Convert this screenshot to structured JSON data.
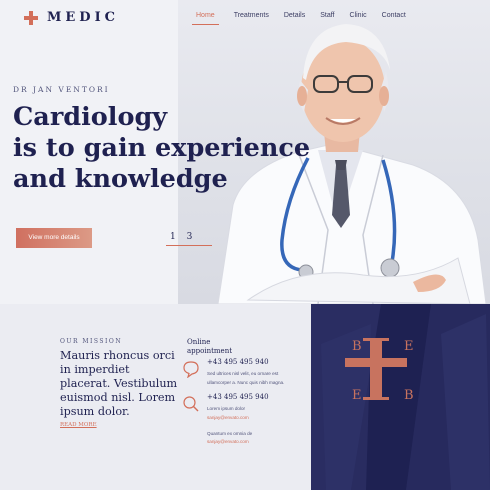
{
  "brand": {
    "name": "MEDIC",
    "accent": "#d36f5a",
    "navy": "#1f2150"
  },
  "nav": [
    {
      "label": "Home",
      "active": true
    },
    {
      "label": "Treatments",
      "active": false
    },
    {
      "label": "Details",
      "active": false
    },
    {
      "label": "Staff",
      "active": false
    },
    {
      "label": "Clinic",
      "active": false
    },
    {
      "label": "Contact",
      "active": false
    }
  ],
  "hero": {
    "eyebrow": "DR JAN VENTORI",
    "headline": [
      "Cardiology",
      "is to gain experience",
      "and knowledge"
    ],
    "cta": "View more details",
    "pager": {
      "current": "1",
      "total": "3"
    }
  },
  "mission": {
    "label": "OUR MISSION",
    "text": "Mauris rhoncus orci in imperdiet placerat. Vestibulum euismod nisl. Lorem ipsum dolor.",
    "readmore": "READ MORE"
  },
  "appointment": {
    "title": "Online appointment",
    "contacts": [
      {
        "icon": "chat-icon",
        "phone": "+43 495 495 940",
        "lines": [
          "Sed ultrices nisl velit, eu ornare est",
          "ullamcorper a. Nunc quis nibh magna."
        ],
        "email": ""
      },
      {
        "icon": "search-icon",
        "phone": "+43 495 495 940",
        "lines": [
          "Lorem ipsum dolor"
        ],
        "email": "sanjay@envato.com"
      }
    ],
    "extra_line": "Quantum ex omnia de",
    "extra_email": "sanjay@envato.com"
  },
  "panel": {
    "letters": [
      "B",
      "E",
      "E",
      "B"
    ]
  }
}
